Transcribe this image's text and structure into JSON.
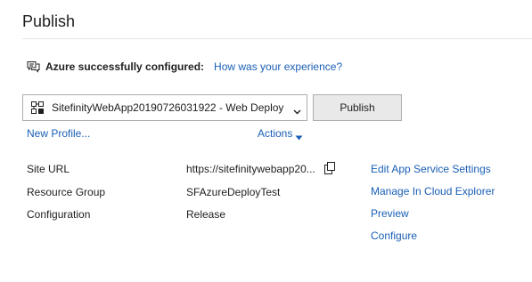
{
  "header": {
    "title": "Publish"
  },
  "status": {
    "icon": "feedback-icon",
    "message": "Azure successfully configured:",
    "feedback_link": "How was your experience?"
  },
  "profile": {
    "selected": "SitefinityWebApp20190726031922 - Web Deploy",
    "icon": "web-deploy-icon",
    "new_profile_link": "New Profile...",
    "actions_label": "Actions"
  },
  "toolbar": {
    "publish_label": "Publish"
  },
  "properties": [
    {
      "label": "Site URL",
      "value": "https://sitefinitywebapp20..."
    },
    {
      "label": "Resource Group",
      "value": "SFAzureDeployTest"
    },
    {
      "label": "Configuration",
      "value": "Release"
    }
  ],
  "side_actions": [
    "Edit App Service Settings",
    "Manage In Cloud Explorer",
    "Preview",
    "Configure"
  ],
  "colors": {
    "link": "#1a5fb4",
    "text": "#1e1e1e",
    "button_bg": "#e9e9e9",
    "border": "#adadad"
  }
}
